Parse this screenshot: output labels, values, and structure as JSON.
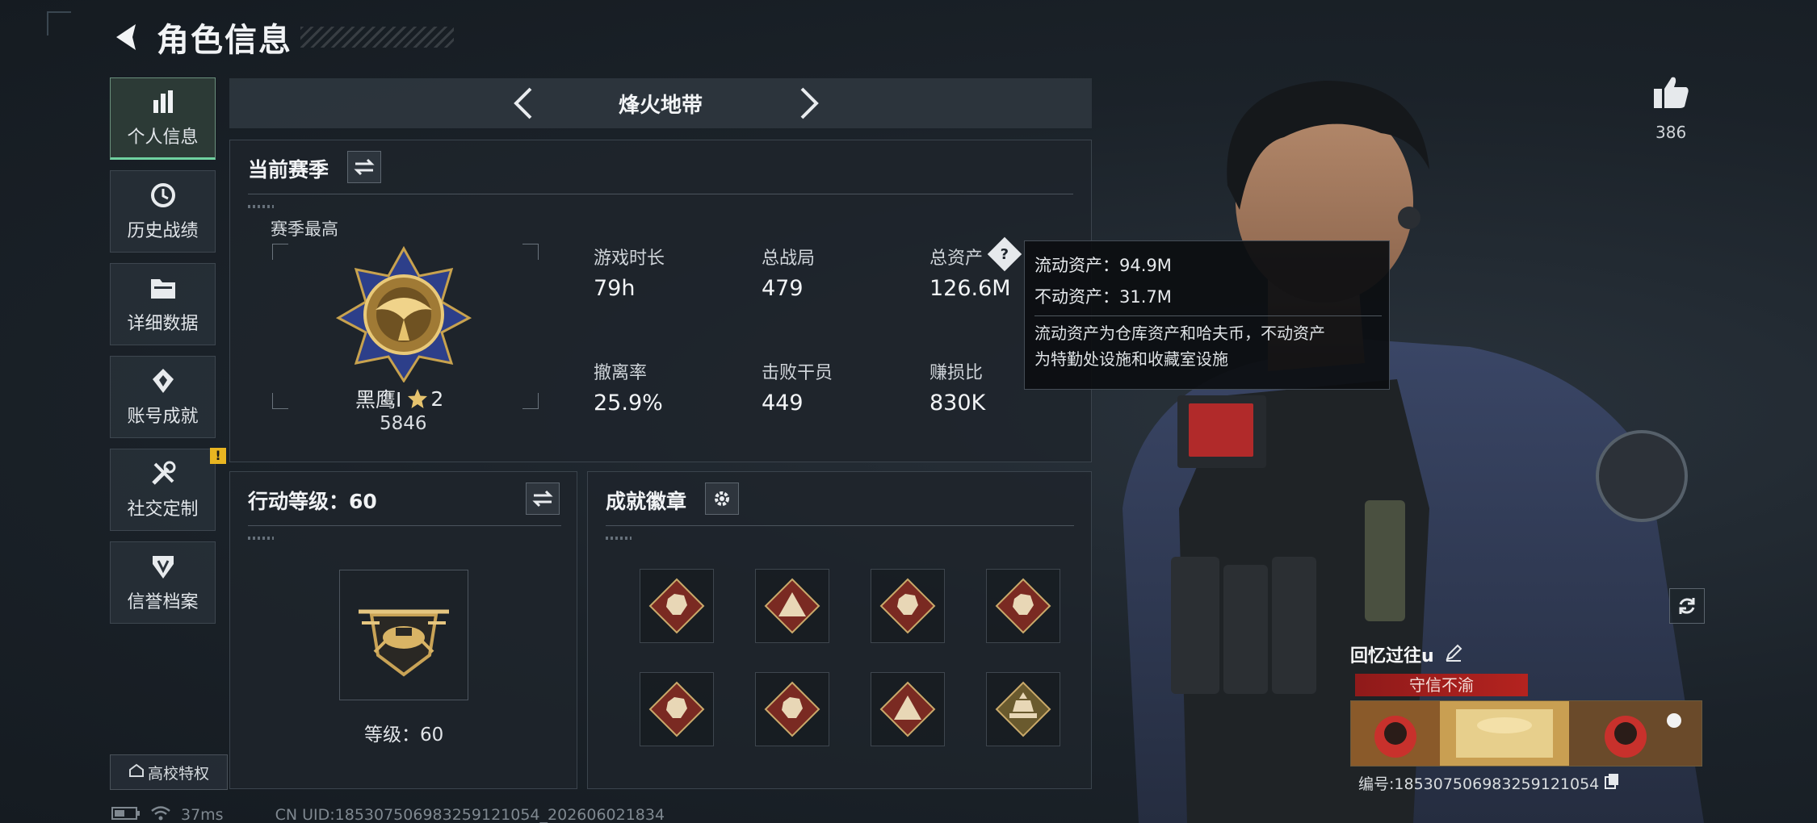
{
  "header": {
    "title": "角色信息"
  },
  "sidebar": {
    "items": [
      {
        "label": "个人信息",
        "icon": "bar-chart-icon",
        "active": true
      },
      {
        "label": "历史战绩",
        "icon": "history-icon"
      },
      {
        "label": "详细数据",
        "icon": "folder-icon"
      },
      {
        "label": "账号成就",
        "icon": "achievement-icon"
      },
      {
        "label": "社交定制",
        "icon": "tools-icon",
        "badge": "!"
      },
      {
        "label": "信誉档案",
        "icon": "shield-icon"
      }
    ],
    "campus_label": "高校特权"
  },
  "mode": {
    "title": "烽火地带"
  },
  "season": {
    "title": "当前赛季",
    "best_label": "赛季最高",
    "rank_name": "黑鹰I",
    "rank_stars": "2",
    "rank_score": "5846",
    "stats": [
      {
        "label": "游戏时长",
        "value": "79h"
      },
      {
        "label": "总战局",
        "value": "479"
      },
      {
        "label": "总资产",
        "value": "126.6M"
      },
      {
        "label": "撤离率",
        "value": "25.9%"
      },
      {
        "label": "击败干员",
        "value": "449"
      },
      {
        "label": "赚损比",
        "value": "830K"
      }
    ]
  },
  "tooltip": {
    "liquid": "流动资产：94.9M",
    "fixed": "不动资产：31.7M",
    "desc_line1": "流动资产为仓库资产和哈夫币，不动资产",
    "desc_line2": "为特勤处设施和收藏室设施"
  },
  "level": {
    "title": "行动等级：60",
    "label": "等级：60"
  },
  "badges": {
    "title": "成就徽章",
    "items": [
      {
        "icon": "wolf-badge-icon",
        "color": "#7a2a22"
      },
      {
        "icon": "pyramid-badge-icon",
        "color": "#7a2a22"
      },
      {
        "icon": "dragon-badge-icon",
        "color": "#7a2a22"
      },
      {
        "icon": "runner-badge-icon",
        "color": "#7a2a22"
      },
      {
        "icon": "dragon-badge-icon",
        "color": "#7a2a22"
      },
      {
        "icon": "wolf-badge-icon",
        "color": "#7a2a22"
      },
      {
        "icon": "eye-pyramid-badge-icon",
        "color": "#7a2a22"
      },
      {
        "icon": "temple-badge-icon",
        "color": "#6a5a2e"
      }
    ]
  },
  "profile": {
    "name": "回忆过往u",
    "title_tag": "守信不渝",
    "serial": "编号:185307506983259121054"
  },
  "likes": {
    "count": "386"
  },
  "status": {
    "ping": "37ms",
    "uid": "CN UID:185307506983259121054_202606021834"
  }
}
